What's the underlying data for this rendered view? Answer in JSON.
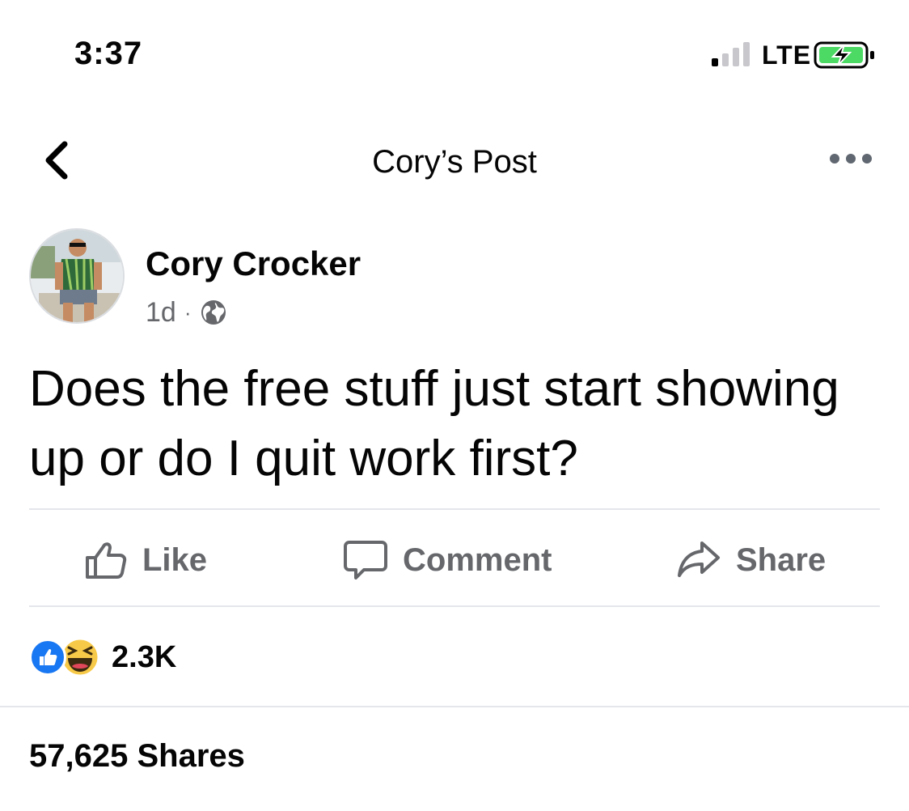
{
  "status_bar": {
    "time": "3:37",
    "network": "LTE"
  },
  "header": {
    "title": "Cory’s Post"
  },
  "post": {
    "author": "Cory Crocker",
    "time_ago": "1d",
    "separator": "·",
    "text": "Does the free stuff just start showing up or do I quit work first?"
  },
  "actions": {
    "like": "Like",
    "comment": "Comment",
    "share": "Share"
  },
  "reactions": {
    "count": "2.3K"
  },
  "shares": {
    "label": "57,625 Shares"
  },
  "colors": {
    "secondary_text": "#65676b",
    "like_blue": "#1877f2",
    "haha_yellow": "#f7c948",
    "divider": "#e4e6eb",
    "battery_green": "#4cd964"
  },
  "icons": [
    "signal-icon",
    "battery-charging-icon",
    "back-chevron-icon",
    "more-dots-icon",
    "globe-icon",
    "thumbs-up-icon",
    "comment-bubble-icon",
    "share-arrow-icon",
    "like-reaction-icon",
    "haha-reaction-icon"
  ]
}
